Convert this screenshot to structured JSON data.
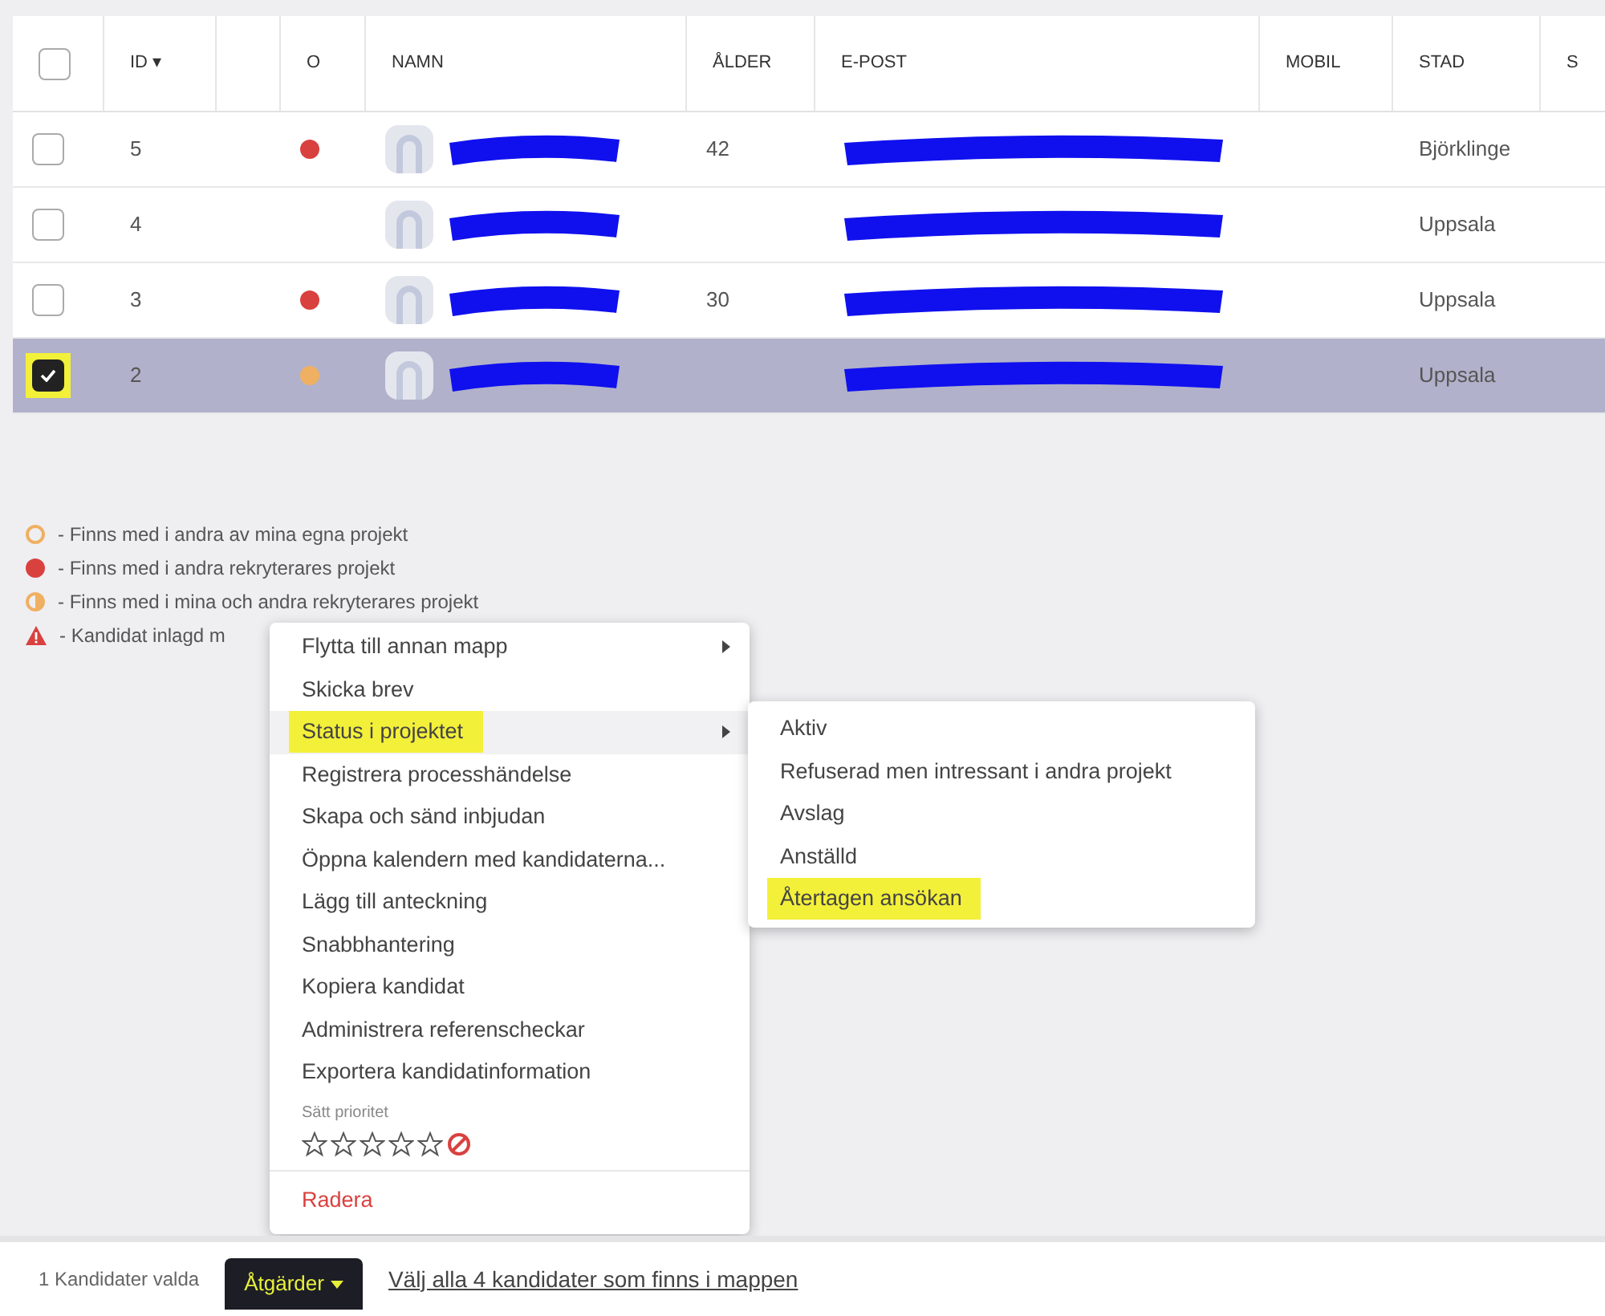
{
  "table": {
    "columns": [
      {
        "kind": "checkbox",
        "checked": false
      },
      {
        "kind": "text",
        "label": "ID ▾"
      },
      {
        "kind": "blank"
      },
      {
        "kind": "text",
        "label": "O"
      },
      {
        "kind": "text",
        "label": "NAMN"
      },
      {
        "kind": "text",
        "label": "ÅLDER"
      },
      {
        "kind": "text",
        "label": "E-POST"
      },
      {
        "kind": "text",
        "label": "MOBIL"
      },
      {
        "kind": "text",
        "label": "STAD"
      },
      {
        "kind": "text",
        "label": "S"
      }
    ],
    "rows": [
      {
        "id": "5",
        "color": "#d9413f",
        "age": "42",
        "city": "Björklinge",
        "selected": false,
        "annotated": false
      },
      {
        "id": "4",
        "city": "Uppsala",
        "selected": false,
        "annotated": false
      },
      {
        "id": "3",
        "color": "#d9413f",
        "age": "30",
        "city": "Uppsala",
        "selected": false,
        "annotated": false
      },
      {
        "id": "2",
        "color": "#f0b062",
        "city": "Uppsala",
        "selected": true,
        "annotated": true
      }
    ]
  },
  "legend": [
    {
      "kind": "ring",
      "color": "#f0b062",
      "text": "- Finns med i andra av mina egna projekt"
    },
    {
      "kind": "dot",
      "color": "#d9413f",
      "text": "- Finns med i andra rekryterares projekt"
    },
    {
      "kind": "half",
      "color": "#f0b062",
      "text": "- Finns med i mina och andra rekryterares projekt"
    },
    {
      "kind": "warning",
      "color": "#d9413f",
      "text": "- Kandidat inlagd m"
    }
  ],
  "menu": {
    "items": [
      {
        "label": "Flytta till annan mapp",
        "submenu": true,
        "highlighted": false,
        "annotated": false
      },
      {
        "label": "Skicka brev",
        "submenu": false,
        "highlighted": false,
        "annotated": false
      },
      {
        "label": "Status i projektet",
        "submenu": true,
        "highlighted": true,
        "annotated": true
      },
      {
        "label": "Registrera processhändelse",
        "submenu": false,
        "highlighted": false,
        "annotated": false
      },
      {
        "label": "Skapa och sänd inbjudan",
        "submenu": false,
        "highlighted": false,
        "annotated": false
      },
      {
        "label": "Öppna kalendern med kandidaterna...",
        "submenu": false,
        "highlighted": false,
        "annotated": false
      },
      {
        "label": "Lägg till anteckning",
        "submenu": false,
        "highlighted": false,
        "annotated": false
      },
      {
        "label": "Snabbhantering",
        "submenu": false,
        "highlighted": false,
        "annotated": false
      },
      {
        "label": "Kopiera kandidat",
        "submenu": false,
        "highlighted": false,
        "annotated": false
      },
      {
        "label": "Administrera referenscheckar",
        "submenu": false,
        "highlighted": false,
        "annotated": false
      },
      {
        "label": "Exportera kandidatinformation",
        "submenu": false,
        "highlighted": false,
        "annotated": false
      }
    ],
    "priority": {
      "label": "Sätt prioritet",
      "stars": 0
    },
    "danger_item": "Radera"
  },
  "submenu": {
    "items": [
      {
        "label": "Aktiv",
        "annotated": false
      },
      {
        "label": "Refuserad men intressant i andra projekt",
        "annotated": false
      },
      {
        "label": "Avslag",
        "annotated": false
      },
      {
        "label": "Anställd",
        "annotated": false
      },
      {
        "label": "Återtagen ansökan",
        "annotated": true
      }
    ]
  },
  "footer": {
    "count": "1 Kandidater valda",
    "actions_button": "Åtgärder",
    "select_all_link": "Välj alla 4 kandidater som finns i mappen"
  }
}
